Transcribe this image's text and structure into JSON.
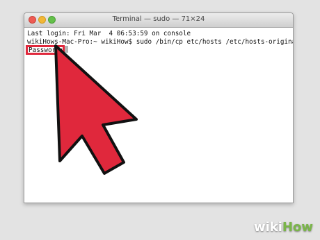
{
  "window": {
    "title": "Terminal — sudo — 71×24"
  },
  "terminal": {
    "lines": [
      "Last login: Fri Mar  4 06:53:59 on console",
      "wikiHows-Mac-Pro:~ wikiHow$ sudo /bin/cp etc/hosts /etc/hosts-original"
    ],
    "password_prompt": "Password:"
  },
  "annotation": {
    "highlight_color": "#e0283c",
    "arrow_color": "#e0283c"
  },
  "watermark": {
    "part1": "wiki",
    "part2": "How"
  }
}
